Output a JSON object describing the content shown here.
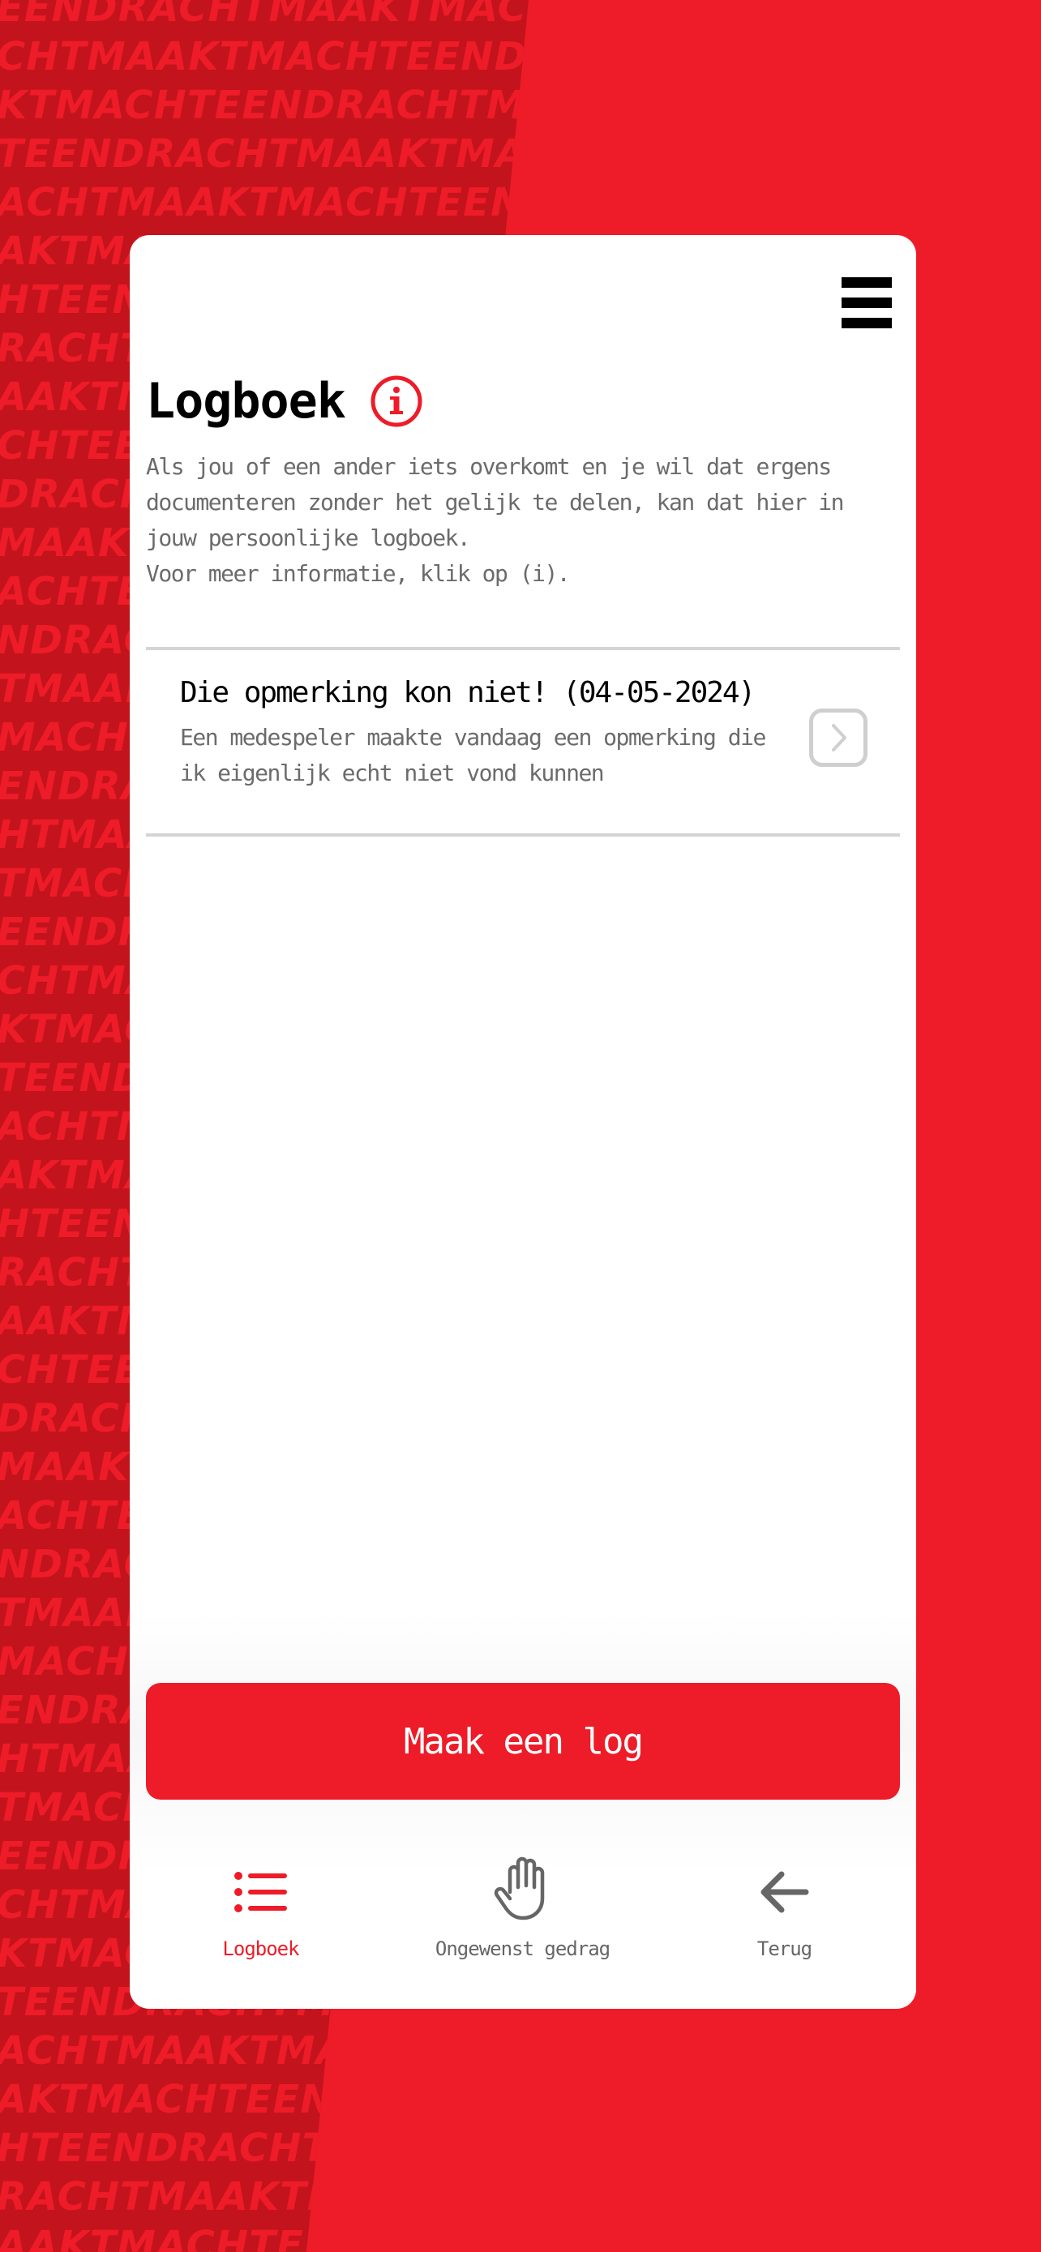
{
  "brand": {
    "primary_color": "#ED1C28",
    "dark_red": "#C3131C",
    "background_word": "EENDRACHTMAAKTMACHT"
  },
  "header": {
    "menu_icon": "hamburger-menu-icon",
    "title": "Logboek",
    "info_icon": "info-circle-icon"
  },
  "intro": {
    "paragraph": "Als jou of een ander iets overkomt en je wil dat ergens documenteren zonder het gelijk te delen, kan dat hier in jouw persoonlijke logboek.",
    "hint": "Voor meer informatie, klik op (i)."
  },
  "logs": [
    {
      "title": "Die opmerking kon niet! (04-05-2024)",
      "description": "Een medespeler maakte vandaag een opmerking die ik eigenlijk echt niet vond kunnen",
      "icon": "chevron-right-icon"
    }
  ],
  "cta": {
    "label": "Maak een log"
  },
  "tabbar": {
    "tabs": [
      {
        "label": "Logboek",
        "icon": "list-icon",
        "active": true
      },
      {
        "label": "Ongewenst gedrag",
        "icon": "hand-stop-icon",
        "active": false
      },
      {
        "label": "Terug",
        "icon": "arrow-left-icon",
        "active": false
      }
    ]
  }
}
